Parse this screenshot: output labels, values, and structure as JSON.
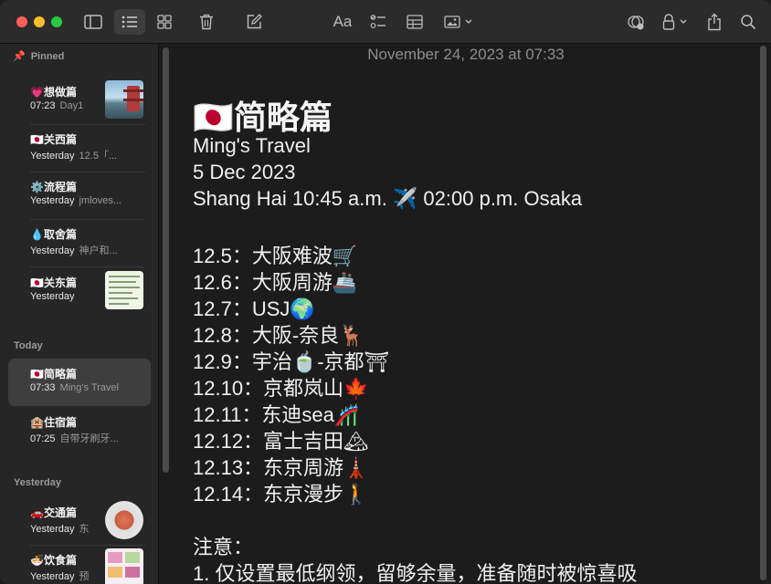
{
  "toolbar": {
    "icons": [
      "sidebar-toggle-icon",
      "list-view-icon",
      "gallery-view-icon",
      "trash-icon",
      "compose-icon",
      "text-format-icon",
      "checklist-icon",
      "table-icon",
      "media-icon",
      "collaborate-icon",
      "lock-icon",
      "share-icon",
      "search-icon"
    ],
    "format_label": "Aa"
  },
  "sidebar": {
    "pinned_label": "Pinned",
    "today_label": "Today",
    "yesterday_label": "Yesterday",
    "pinned": [
      {
        "title": "💗想做篇",
        "time": "07:23",
        "preview": "Day1"
      },
      {
        "title": "🇯🇵关西篇",
        "time": "Yesterday",
        "preview": "12.5「..."
      },
      {
        "title": "⚙️流程篇",
        "time": "Yesterday",
        "preview": "jmloves..."
      },
      {
        "title": "💧取舍篇",
        "time": "Yesterday",
        "preview": "神户和..."
      },
      {
        "title": "🇯🇵关东篇",
        "time": "Yesterday",
        "preview": ""
      }
    ],
    "today": [
      {
        "title": "🇯🇵简略篇",
        "time": "07:33",
        "preview": "Ming's Travel"
      },
      {
        "title": "🏨住宿篇",
        "time": "07:25",
        "preview": "自带牙刷牙..."
      }
    ],
    "yesterday": [
      {
        "title": "🚗交通篇",
        "time": "Yesterday",
        "preview": "东"
      },
      {
        "title": "🍜饮食篇",
        "time": "Yesterday",
        "preview": "预"
      }
    ]
  },
  "note": {
    "date": "November 24, 2023 at 07:33",
    "title": "🇯🇵简略篇",
    "lines": [
      "Ming's Travel",
      "5 Dec 2023",
      "Shang Hai 10:45 a.m. ✈️ 02:00 p.m. Osaka",
      "",
      "12.5：大阪难波🛒",
      "12.6：大阪周游🚢",
      "12.7：USJ🌍",
      "12.8：大阪-奈良🦌",
      "12.9：宇治🍵-京都⛩",
      "12.10：京都岚山🍁",
      "12.11：东迪sea🎢",
      "12.12：富士吉田🏔",
      "12.13：东京周游🗼",
      "12.14：东京漫步🚶",
      "",
      "注意：",
      " 1. 仅设置最低纲领，留够余量，准备随时被惊喜吸"
    ]
  },
  "colors": {
    "close": "#ff5f57",
    "minimize": "#febc2e",
    "zoom": "#28c840"
  }
}
